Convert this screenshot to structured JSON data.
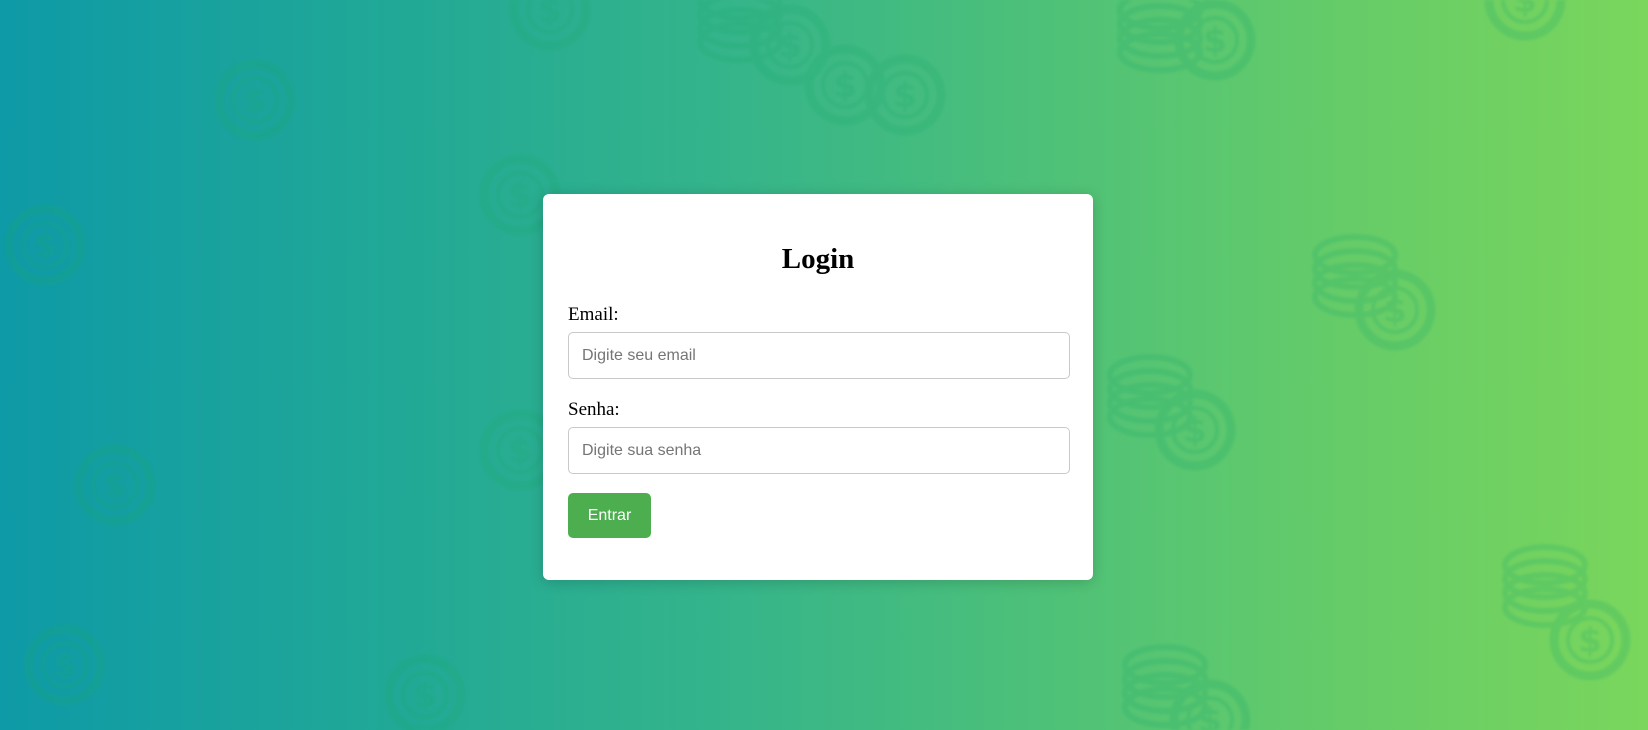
{
  "background": {
    "gradient_start": "#0e9aa7",
    "gradient_end": "#7ad65c",
    "pattern_icon": "dollar-coin-stack-icon"
  },
  "login": {
    "title": "Login",
    "email_label": "Email:",
    "email_placeholder": "Digite seu email",
    "password_label": "Senha:",
    "password_placeholder": "Digite sua senha",
    "submit_label": "Entrar",
    "button_color": "#4cae4f"
  }
}
